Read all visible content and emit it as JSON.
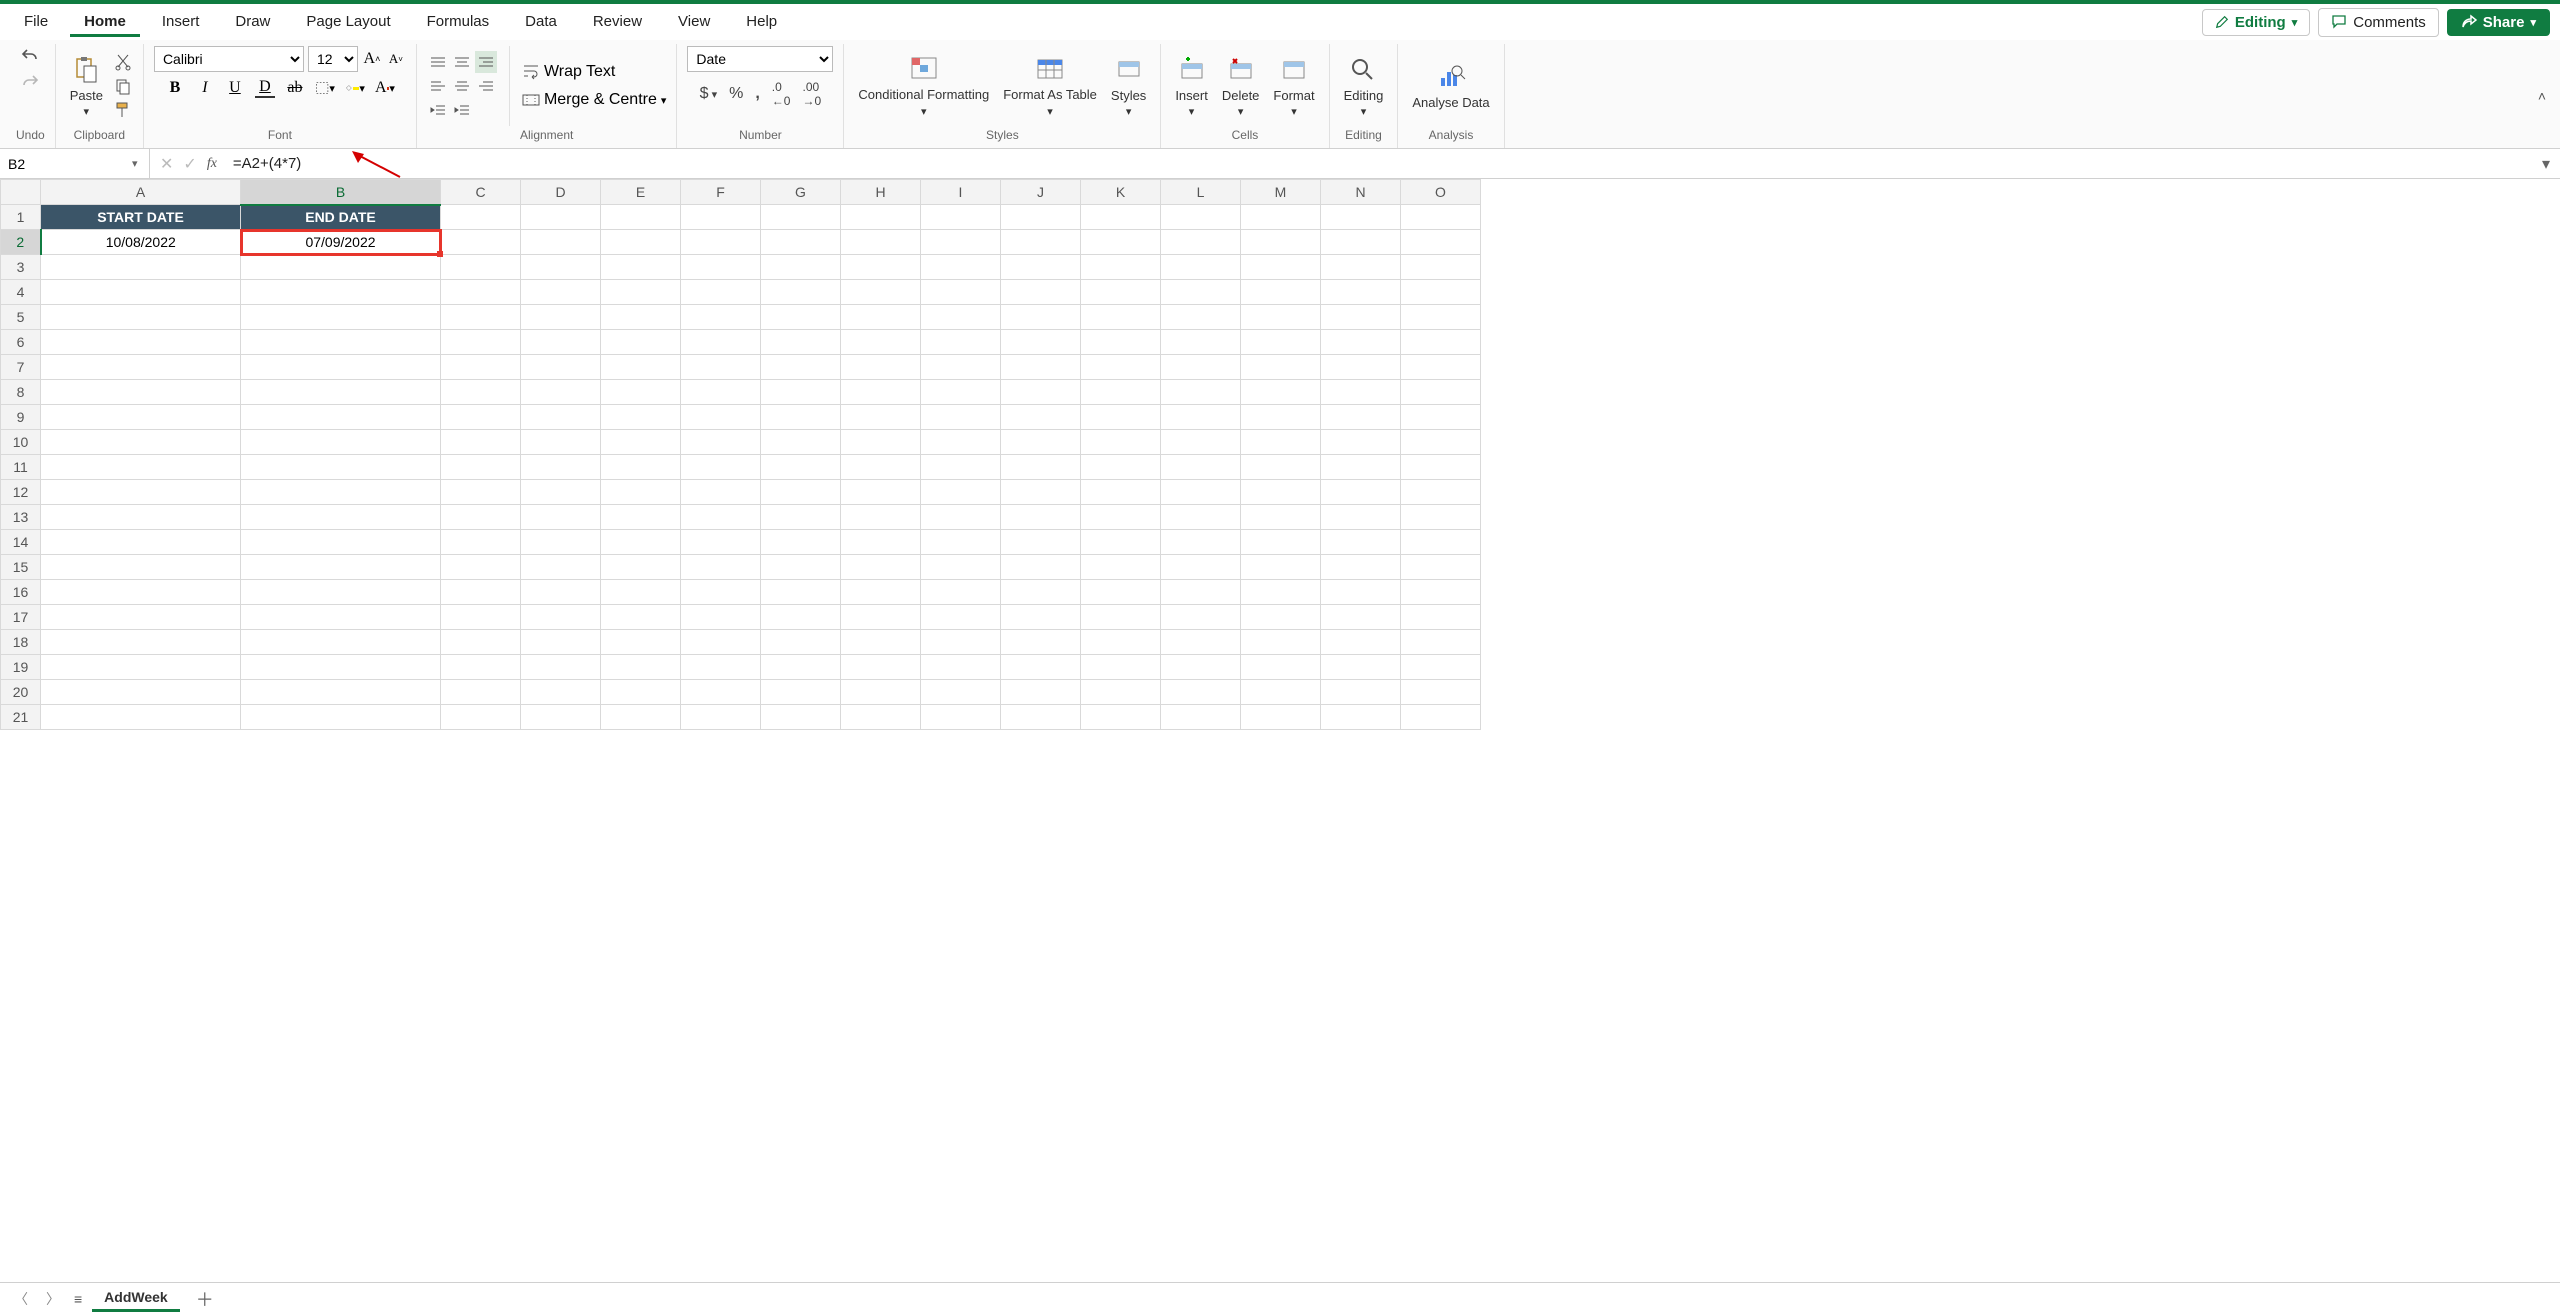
{
  "tabs": {
    "file": "File",
    "home": "Home",
    "insert": "Insert",
    "draw": "Draw",
    "page_layout": "Page Layout",
    "formulas": "Formulas",
    "data": "Data",
    "review": "Review",
    "view": "View",
    "help": "Help",
    "active": "home"
  },
  "top_buttons": {
    "editing": "Editing",
    "comments": "Comments",
    "share": "Share"
  },
  "ribbon": {
    "undo_group": "Undo",
    "clipboard": {
      "paste": "Paste",
      "label": "Clipboard"
    },
    "font": {
      "name": "Calibri",
      "size": "12",
      "label": "Font"
    },
    "alignment": {
      "wrap": "Wrap Text",
      "merge": "Merge & Centre",
      "label": "Alignment"
    },
    "number": {
      "format": "Date",
      "label": "Number"
    },
    "styles": {
      "cond": "Conditional Formatting",
      "table": "Format As Table",
      "styles": "Styles",
      "label": "Styles"
    },
    "cells": {
      "insert": "Insert",
      "delete": "Delete",
      "format": "Format",
      "label": "Cells"
    },
    "editing": {
      "btn": "Editing",
      "label": "Editing"
    },
    "analysis": {
      "btn": "Analyse Data",
      "label": "Analysis"
    }
  },
  "formula_bar": {
    "cell_ref": "B2",
    "formula": "=A2+(4*7)"
  },
  "columns": [
    "A",
    "B",
    "C",
    "D",
    "E",
    "F",
    "G",
    "H",
    "I",
    "J",
    "K",
    "L",
    "M",
    "N",
    "O"
  ],
  "row_count": 21,
  "selected_col_index": 1,
  "selected_row": 2,
  "headers": {
    "A1": "START DATE",
    "B1": "END DATE"
  },
  "values": {
    "A2": "10/08/2022",
    "B2": "07/09/2022"
  },
  "sheet": {
    "name": "AddWeek"
  }
}
